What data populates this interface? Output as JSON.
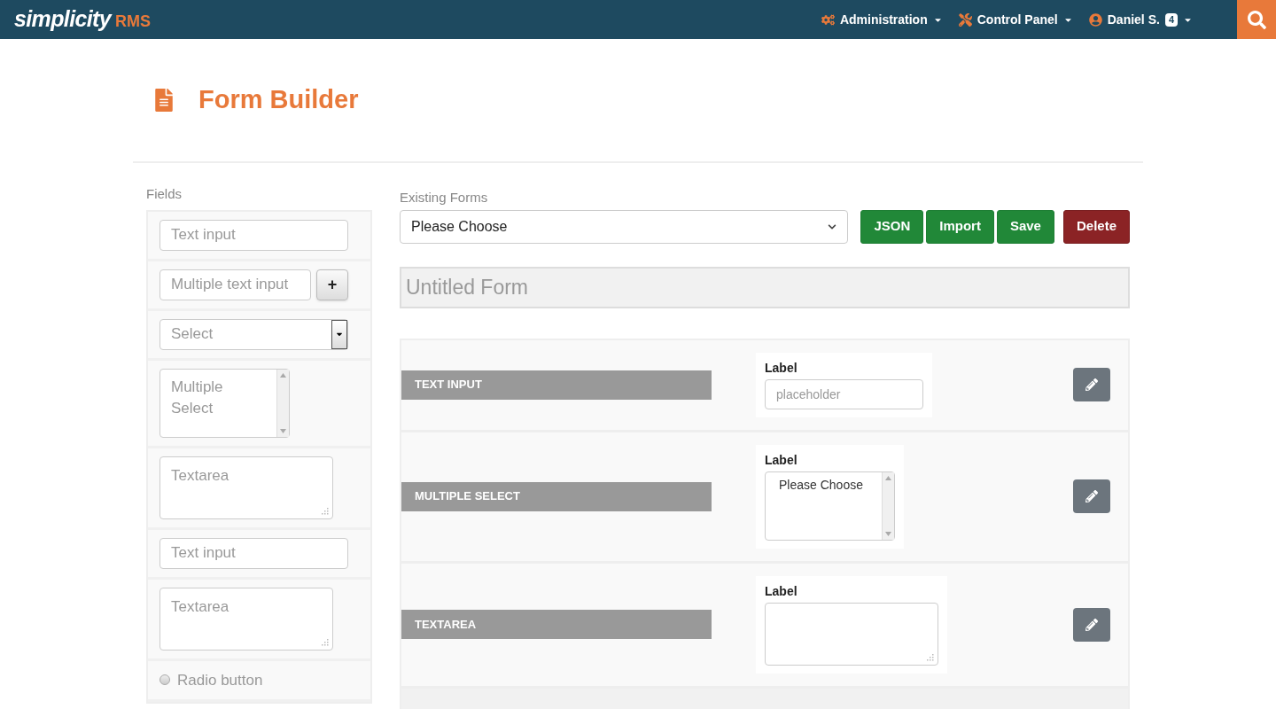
{
  "navbar": {
    "logo_main": "simplicity",
    "logo_accent": "RMS",
    "menus": [
      {
        "label": "Administration",
        "kind": "gears"
      },
      {
        "label": "Control Panel",
        "kind": "tools"
      },
      {
        "label": "Daniel S.",
        "kind": "user",
        "badge": "4"
      }
    ]
  },
  "page": {
    "title": "Form Builder"
  },
  "fields_panel": {
    "heading": "Fields",
    "items": [
      {
        "kind": "text",
        "placeholder": "Text input"
      },
      {
        "kind": "multi_text",
        "placeholder": "Multiple text input",
        "button": "+"
      },
      {
        "kind": "select",
        "placeholder": "Select"
      },
      {
        "kind": "multi_select",
        "placeholder": "Multiple Select"
      },
      {
        "kind": "textarea",
        "placeholder": "Textarea"
      },
      {
        "kind": "text",
        "placeholder": "Text input"
      },
      {
        "kind": "textarea",
        "placeholder": "Textarea"
      },
      {
        "kind": "radio",
        "label": "Radio button",
        "checked": false
      }
    ]
  },
  "existing_forms": {
    "label": "Existing Forms",
    "value": "Please Choose",
    "buttons": [
      {
        "label": "JSON",
        "kind": "success"
      },
      {
        "label": "Import",
        "kind": "success"
      },
      {
        "label": "Save",
        "kind": "success"
      },
      {
        "label": "Delete",
        "kind": "danger"
      }
    ]
  },
  "form_title": {
    "placeholder": "Untitled Form"
  },
  "stage": {
    "rows": [
      {
        "kind": "text",
        "title": "TEXT INPUT",
        "label": "Label",
        "placeholder": "placeholder"
      },
      {
        "kind": "multi_select",
        "title": "MULTIPLE SELECT",
        "label": "Label",
        "option": "Please Choose"
      },
      {
        "kind": "textarea",
        "title": "TEXTAREA",
        "label": "Label"
      }
    ]
  }
}
